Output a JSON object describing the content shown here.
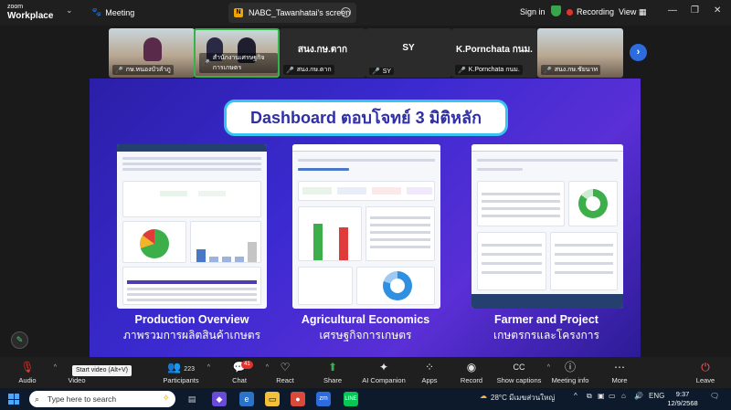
{
  "app": {
    "logo_line1": "zoom",
    "logo_line2": "Workplace",
    "meeting_label": "Meeting",
    "tab_badge": "N",
    "tab_title": "NABC_Tawanhatai's screen",
    "sign_in": "Sign in",
    "recording": "Recording",
    "view": "View"
  },
  "participants": [
    {
      "name": "กษ.หนองบัวลำภู",
      "big": ""
    },
    {
      "name": "สำนักงานเศรษฐกิจการเกษตร",
      "big": ""
    },
    {
      "name": "สนง.กษ.ตาก",
      "big": "สนง.กษ.ตาก"
    },
    {
      "name": "SY",
      "big": "SY"
    },
    {
      "name": "K.Pornchata กนม.",
      "big": "K.Pornchata กนม."
    },
    {
      "name": "สนง.กษ.ชัยนาท",
      "big": ""
    }
  ],
  "slide": {
    "title": "Dashboard ตอบโจทย์ 3 มิติหลัก",
    "cards": [
      {
        "en": "Production Overview",
        "th": "ภาพรวมการผลิตสินค้าเกษตร"
      },
      {
        "en": "Agricultural Economics",
        "th": "เศรษฐกิจการเกษตร"
      },
      {
        "en": "Farmer and Project",
        "th": "เกษตรกรและโครงการ"
      }
    ]
  },
  "toolbar": {
    "audio": "Audio",
    "video": "Video",
    "video_tooltip": "Start video (Alt+V)",
    "participants": "Participants",
    "participants_count": "223",
    "chat": "Chat",
    "chat_badge": "41",
    "react": "React",
    "share": "Share",
    "ai_companion": "AI Companion",
    "apps": "Apps",
    "record": "Record",
    "show_captions": "Show captions",
    "meeting_info": "Meeting info",
    "more": "More",
    "leave": "Leave"
  },
  "taskbar": {
    "search_placeholder": "Type here to search",
    "weather": "28°C มีเมฆส่วนใหญ่",
    "lang": "ENG",
    "time": "9:37",
    "date": "12/9/2568"
  },
  "colors": {
    "accent_green": "#35b24a",
    "record_red": "#e0332d",
    "slide_bg": "#3a2ad0",
    "chart_green": "#3cae4a",
    "chart_red": "#e03a3a"
  }
}
